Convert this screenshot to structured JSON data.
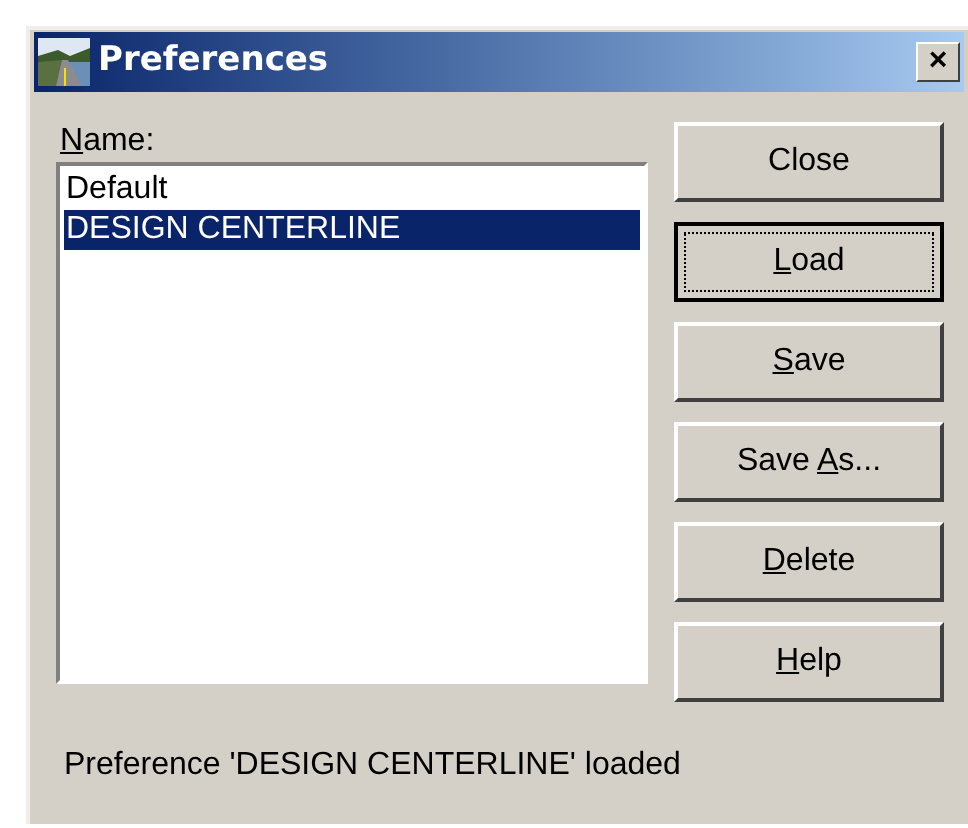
{
  "window": {
    "title": "Preferences",
    "close": "×"
  },
  "name_label": {
    "key": "N",
    "post": "ame:"
  },
  "list": [
    {
      "text": "Default",
      "selected": false
    },
    {
      "text": "DESIGN CENTERLINE",
      "selected": true
    }
  ],
  "buttons": [
    {
      "pre": "Close",
      "default": false
    },
    {
      "key": "L",
      "post": "oad",
      "default": true
    },
    {
      "key": "S",
      "post": "ave",
      "default": false
    },
    {
      "pre": "Save ",
      "key": "A",
      "post": "s...",
      "default": false
    },
    {
      "key": "D",
      "post": "elete",
      "default": false
    },
    {
      "key": "H",
      "post": "elp",
      "default": false
    }
  ],
  "status": "Preference 'DESIGN CENTERLINE' loaded"
}
